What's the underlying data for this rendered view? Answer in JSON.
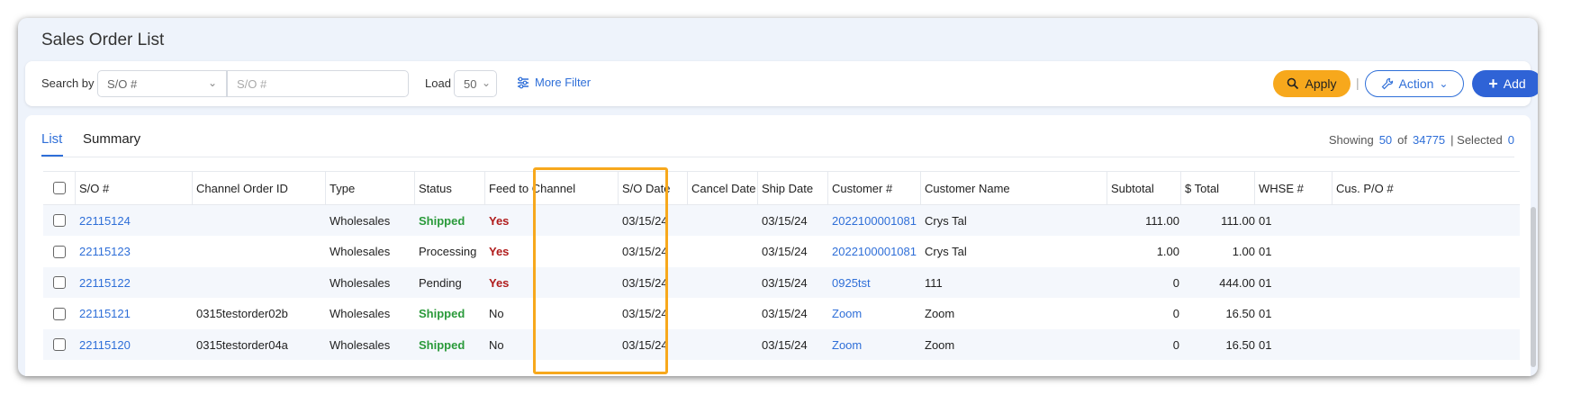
{
  "page": {
    "title": "Sales Order List"
  },
  "filter": {
    "search_by_label": "Search by",
    "search_field_value": "S/O #",
    "search_placeholder": "S/O #",
    "load_label": "Load",
    "load_value": "50",
    "more_filter_label": "More Filter"
  },
  "toolbar": {
    "apply_label": "Apply",
    "separator": "|",
    "action_label": "Action",
    "add_label": "Add"
  },
  "tabs": [
    {
      "label": "List"
    },
    {
      "label": "Summary"
    }
  ],
  "summary": {
    "showing_label": "Showing",
    "showing_count": "50",
    "of_label": "of",
    "total": "34775",
    "selected_label": "| Selected",
    "selected_count": "0"
  },
  "table": {
    "columns": [
      "S/O #",
      "Channel Order ID",
      "Type",
      "Status",
      "Feed to Channel",
      "S/O Date",
      "Cancel Date",
      "Ship Date",
      "Customer #",
      "Customer Name",
      "Subtotal",
      "$ Total",
      "WHSE #",
      "Cus. P/O #"
    ],
    "rows": [
      {
        "so": "22115124",
        "channel_order_id": "",
        "type": "Wholesales",
        "status": "Shipped",
        "feed": "Yes",
        "so_date": "03/15/24",
        "cancel_date": "",
        "ship_date": "03/15/24",
        "customer_no": "2022100001081",
        "customer_name": "Crys Tal",
        "subtotal": "111.00",
        "total": "111.00",
        "whse": "01"
      },
      {
        "so": "22115123",
        "channel_order_id": "",
        "type": "Wholesales",
        "status": "Processing",
        "feed": "Yes",
        "so_date": "03/15/24",
        "cancel_date": "",
        "ship_date": "03/15/24",
        "customer_no": "2022100001081",
        "customer_name": "Crys Tal",
        "subtotal": "1.00",
        "total": "1.00",
        "whse": "01"
      },
      {
        "so": "22115122",
        "channel_order_id": "",
        "type": "Wholesales",
        "status": "Pending",
        "feed": "Yes",
        "so_date": "03/15/24",
        "cancel_date": "",
        "ship_date": "03/15/24",
        "customer_no": "0925tst",
        "customer_name": "111",
        "subtotal": "0",
        "total": "444.00",
        "whse": "01"
      },
      {
        "so": "22115121",
        "channel_order_id": "0315testorder02b",
        "type": "Wholesales",
        "status": "Shipped",
        "feed": "No",
        "so_date": "03/15/24",
        "cancel_date": "",
        "ship_date": "03/15/24",
        "customer_no": "Zoom",
        "customer_name": "Zoom",
        "subtotal": "0",
        "total": "16.50",
        "whse": "01"
      },
      {
        "so": "22115120",
        "channel_order_id": "0315testorder04a",
        "type": "Wholesales",
        "status": "Shipped",
        "feed": "No",
        "so_date": "03/15/24",
        "cancel_date": "",
        "ship_date": "03/15/24",
        "customer_no": "Zoom",
        "customer_name": "Zoom",
        "subtotal": "0",
        "total": "16.50",
        "whse": "01"
      }
    ]
  },
  "icons": {
    "search": "search-icon",
    "action": "wrench-icon",
    "add": "plus-icon",
    "more_filter": "sliders-icon"
  },
  "colors": {
    "accent": "#2f6fd8",
    "apply": "#f7a81c",
    "shipped": "#2a9a3a",
    "feed_yes": "#b01c1c",
    "highlight": "#f7a81c"
  }
}
